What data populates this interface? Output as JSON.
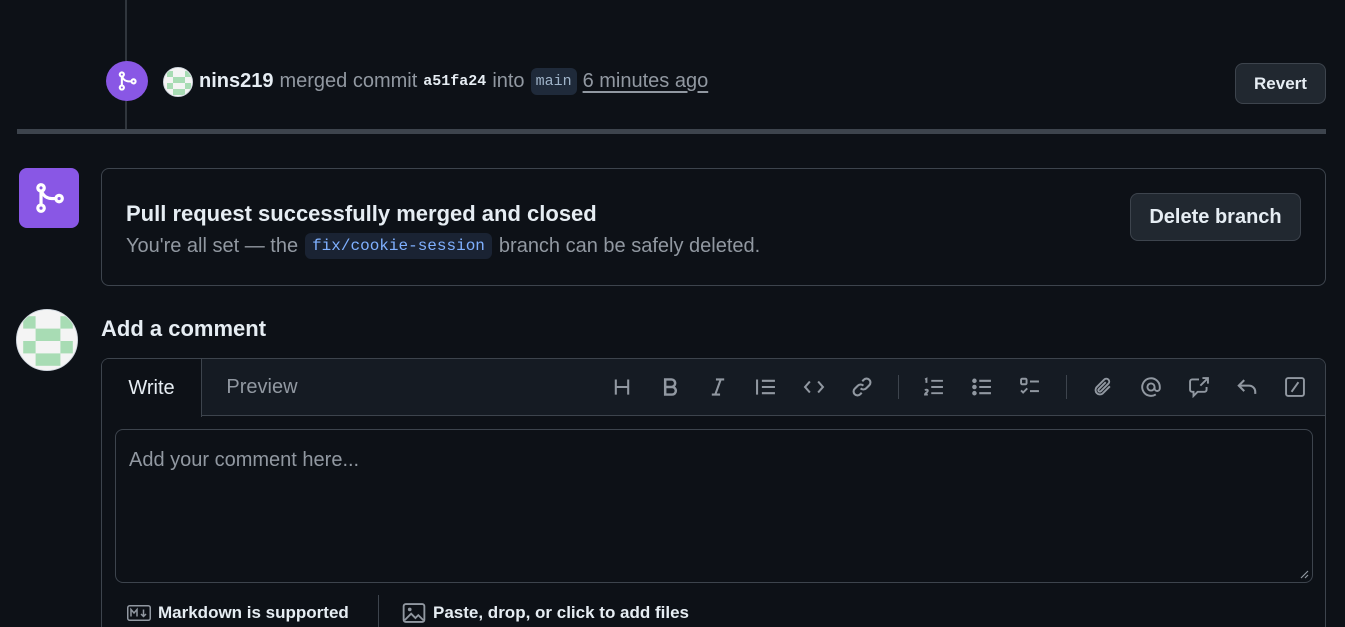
{
  "event": {
    "actor": "nins219",
    "action": "merged commit",
    "sha": "a51fa24",
    "into": "into",
    "branch": "main",
    "time": "6 minutes ago",
    "revert_label": "Revert"
  },
  "merged": {
    "title": "Pull request successfully merged and closed",
    "sub_before": "You're all set — the",
    "branch": "fix/cookie-session",
    "sub_after": "branch can be safely deleted.",
    "delete_label": "Delete branch"
  },
  "comment": {
    "heading": "Add a comment",
    "tabs": [
      "Write",
      "Preview"
    ],
    "placeholder": "Add your comment here...",
    "markdown_label": "Markdown is supported",
    "files_label": "Paste, drop, or click to add files"
  },
  "toolbar": {
    "icons": [
      "heading-icon",
      "bold-icon",
      "italic-icon",
      "quote-icon",
      "code-icon",
      "link-icon",
      "numbered-list-icon",
      "unordered-list-icon",
      "task-list-icon",
      "attach-icon",
      "mention-icon",
      "cross-reference-icon",
      "reply-icon",
      "slash-command-icon"
    ]
  },
  "colors": {
    "background": "#0d1117",
    "merged_purple": "#8957e5",
    "border": "#3d444d",
    "muted_text": "#9198a1",
    "branch_code": "#7fb0ff"
  }
}
